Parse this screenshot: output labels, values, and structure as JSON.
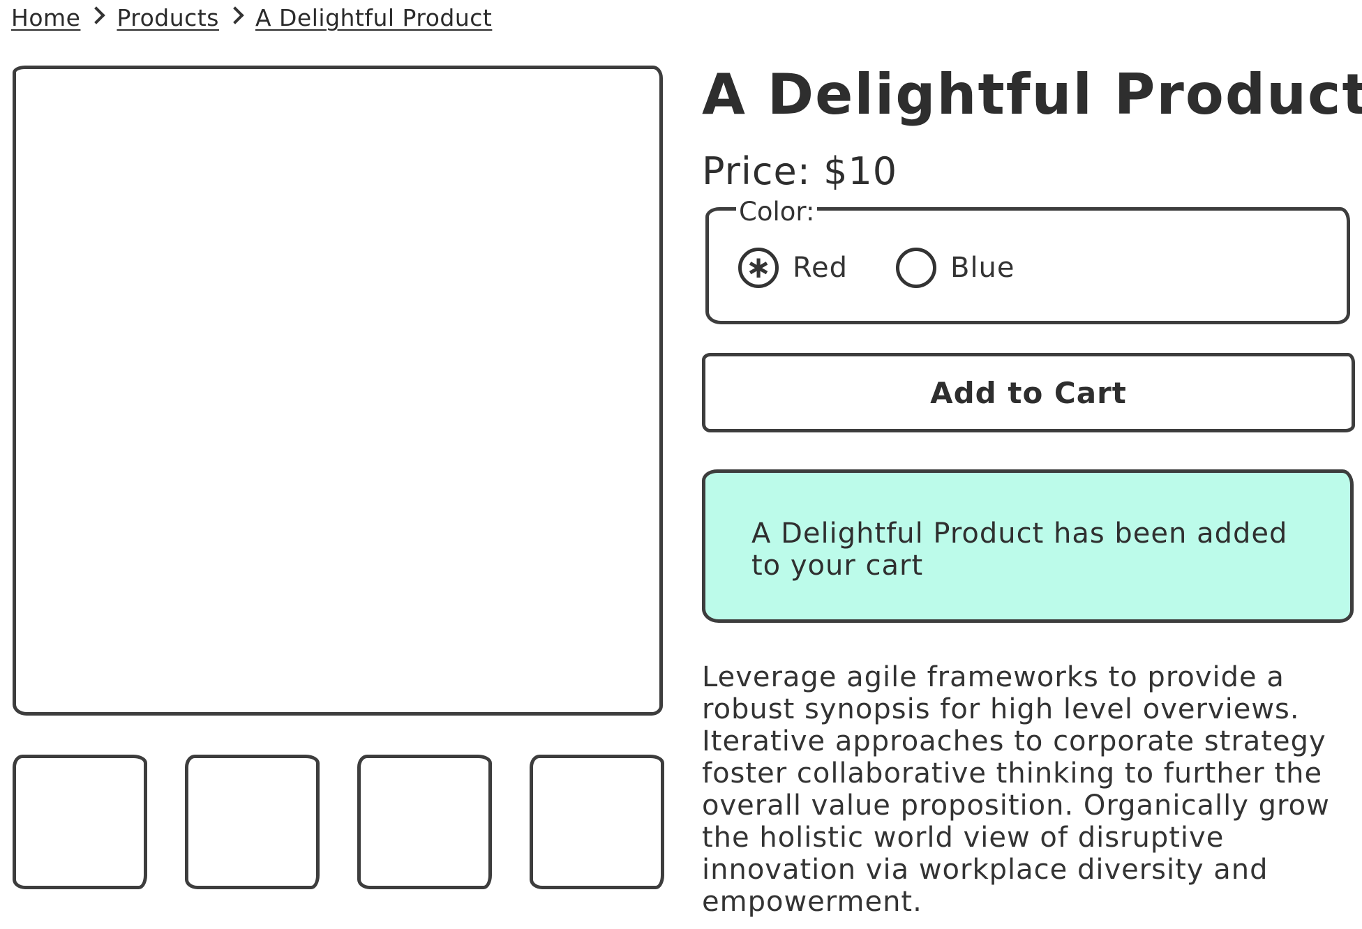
{
  "breadcrumb": {
    "items": [
      "Home",
      "Products",
      "A Delightful Product"
    ]
  },
  "product": {
    "title": "A Delightful Product",
    "price": "Price: $10",
    "color_legend": "Color:",
    "color_options": [
      {
        "label": "Red",
        "selected": true
      },
      {
        "label": "Blue",
        "selected": false
      }
    ],
    "add_to_cart_label": "Add to Cart",
    "cart_alert": "A Delightful Product has been added to your cart",
    "description": "Leverage agile frameworks to provide a robust synopsis for high level overviews. Iterative approaches to corporate strategy foster collaborative thinking to further the overall value proposition. Organically grow the holistic world view of disruptive innovation via workplace diversity and empowerment."
  },
  "colors": {
    "alert_background": "#bcfbea",
    "border": "#3d3d3d",
    "text": "#333333"
  },
  "icons": {
    "selected_radio": "asterisk-icon",
    "breadcrumb_separator": "chevron-right-icon"
  }
}
